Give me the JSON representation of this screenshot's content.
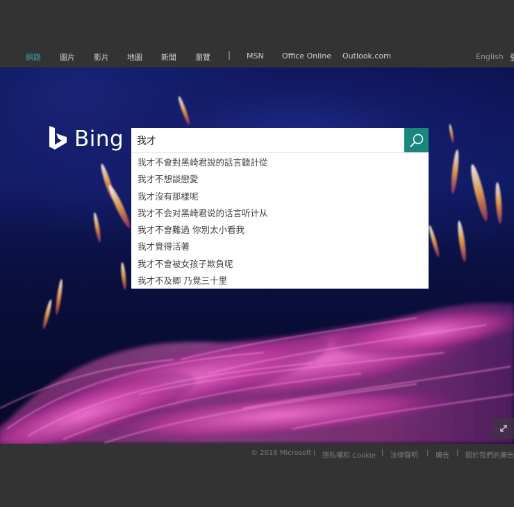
{
  "nav": {
    "items": [
      {
        "label": "網路",
        "active": true
      },
      {
        "label": "圖片",
        "active": false
      },
      {
        "label": "影片",
        "active": false
      },
      {
        "label": "地圖",
        "active": false
      },
      {
        "label": "新聞",
        "active": false
      },
      {
        "label": "瀏覽",
        "active": false
      }
    ],
    "separator": "|",
    "links": [
      "MSN",
      "Office Online",
      "Outlook.com"
    ],
    "language": "English",
    "signin": "登"
  },
  "logo": {
    "text": "Bing"
  },
  "search": {
    "value": "我才",
    "placeholder": ""
  },
  "suggestions": [
    "我才不會對黑崎君說的話言聽計從",
    "我才不想談戀愛",
    "我才沒有那樣呢",
    "我才不会对黑崎君说的话言听计从",
    "我才不會難過 你別太小看我",
    "我才覺得活著",
    "我才不會被女孩子欺負呢",
    "我才不及卿 乃覺三十里"
  ],
  "footer": {
    "copyright": "© 2016 Microsoft",
    "separator": "|",
    "links": [
      "隱私權和 Cookie",
      "法律聲明",
      "廣告",
      "關於我們的廣告"
    ]
  },
  "colors": {
    "accent": "#19877e",
    "nav_active": "#3d9fa3",
    "background": "#333333"
  },
  "icons": {
    "search": "search-icon",
    "expand": "expand-icon",
    "logo": "bing-logo-icon"
  }
}
